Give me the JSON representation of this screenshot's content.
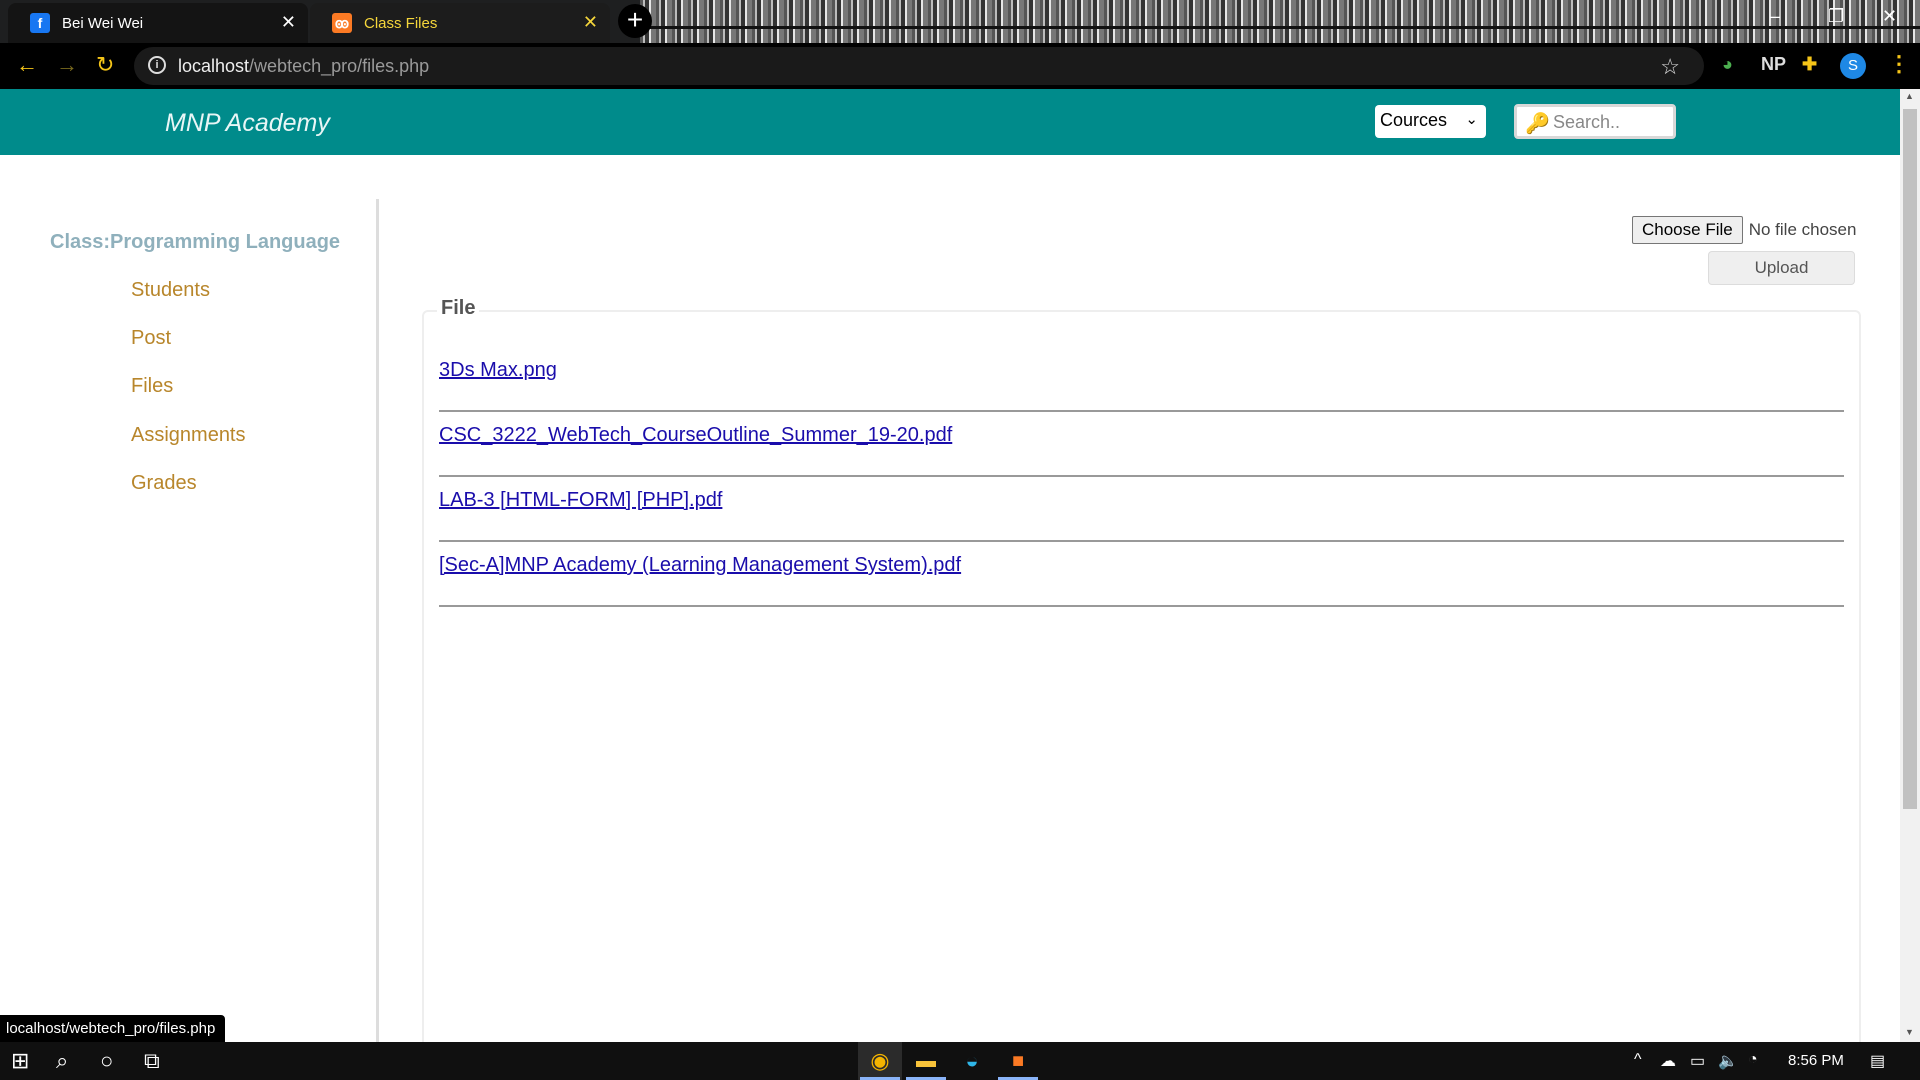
{
  "browser": {
    "tabs": [
      {
        "title": "Bei Wei Wei",
        "favicon": "facebook-icon",
        "active": false
      },
      {
        "title": "Class Files",
        "favicon": "xampp-icon",
        "active": true
      }
    ],
    "new_tab": "+",
    "address": {
      "host": "localhost",
      "path": "/webtech_pro/files.php"
    },
    "extensions": {
      "np": "NP"
    },
    "profile_initial": "S",
    "status_url": "localhost/webtech_pro/files.php"
  },
  "header": {
    "brand": "MNP Academy",
    "courses_select": "Cources",
    "search_placeholder": "Search.."
  },
  "sidebar": {
    "class_title": "Class:Programming Language",
    "items": [
      "Students",
      "Post",
      "Files",
      "Assignments",
      "Grades"
    ]
  },
  "upload": {
    "choose_label": "Choose File",
    "no_file": "No file chosen",
    "upload_label": "Upload"
  },
  "files": {
    "legend": "File",
    "items": [
      "3Ds Max.png",
      "CSC_3222_WebTech_CourseOutline_Summer_19-20.pdf",
      "LAB-3 [HTML-FORM] [PHP].pdf",
      "[Sec-A]MNP Academy (Learning Management System).pdf"
    ]
  },
  "taskbar": {
    "time": "8:56 PM"
  },
  "colors": {
    "header": "#008b8b",
    "sidebar_link": "#b8862b",
    "class_title": "#8fb0bc",
    "file_link": "#1a0dab",
    "accent_yellow": "#f5c518"
  }
}
